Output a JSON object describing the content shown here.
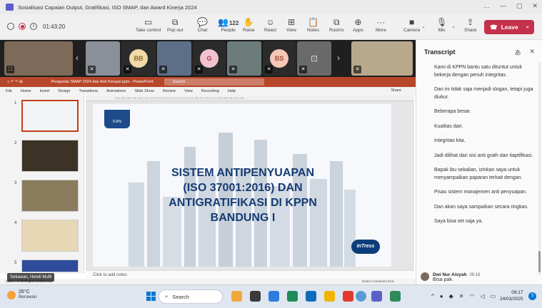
{
  "window": {
    "title": "Sosialisasi Capaian Output, Gratifikasi, ISO SMAP, dan Award Kinerja 2024",
    "controls": [
      "…",
      "—",
      "▢",
      "✕"
    ]
  },
  "meeting": {
    "timer": "01:43:20",
    "buttons": [
      {
        "label": "Take control",
        "icon": "▭"
      },
      {
        "label": "Pop out",
        "icon": "⧉"
      },
      {
        "label": "Chat",
        "icon": "💬"
      },
      {
        "label": "People",
        "icon": "👥",
        "count": "122"
      },
      {
        "label": "Raise",
        "icon": "✋"
      },
      {
        "label": "React",
        "icon": "☺"
      },
      {
        "label": "View",
        "icon": "⊞"
      },
      {
        "label": "Notes",
        "icon": "📋"
      },
      {
        "label": "Rooms",
        "icon": "⧉"
      },
      {
        "label": "Apps",
        "icon": "⊕"
      },
      {
        "label": "More",
        "icon": "···"
      },
      {
        "label": "Camera",
        "icon": "■"
      },
      {
        "label": "Mic",
        "icon": "🎙"
      },
      {
        "label": "Share",
        "icon": "⇪"
      }
    ],
    "leave_label": "Leave"
  },
  "participants": [
    {
      "type": "video",
      "color": "#7d6a58"
    },
    {
      "type": "video",
      "color": "#8a8f99"
    },
    {
      "type": "avatar",
      "initials": "BB",
      "bg": "#f1d9a8",
      "fg": "#8a6a2a"
    },
    {
      "type": "video",
      "color": "#5d6f86"
    },
    {
      "type": "avatar",
      "initials": "G",
      "bg": "#f3c2cf",
      "fg": "#a23a5a"
    },
    {
      "type": "video",
      "color": "#6b7c7a"
    },
    {
      "type": "avatar",
      "initials": "BS",
      "bg": "#f5c8b8",
      "fg": "#a04a35"
    },
    {
      "type": "avatar",
      "initials": "",
      "bg": "#6a6a6a",
      "fg": "#ddd"
    },
    {
      "type": "video",
      "color": "#b8a88c"
    }
  ],
  "ppt": {
    "filename": "Pengantar SMAP 2024 dan Anti Korupsi.pptx - PowerPoint",
    "search_placeholder": "Search",
    "menu": [
      "File",
      "Home",
      "Insert",
      "Design",
      "Transitions",
      "Animations",
      "Slide Show",
      "Review",
      "View",
      "Recording",
      "Help"
    ],
    "share_label": "Share",
    "slide_numbers": [
      "1",
      "2",
      "3",
      "4",
      "5"
    ],
    "slide_title_lines": [
      "SISTEM ANTIPENYUAPAN",
      "(ISO 37001:2016)  DAN",
      "ANTIGRATIFIKASI DI KPPN",
      "BANDUNG I"
    ],
    "logo_text": "DJPb",
    "badge_text": "InTress",
    "notes_placeholder": "Click to add notes",
    "status_text": "Slide 1 of 18    English (Indonesia)",
    "status_right": "Notes   Comments          51%"
  },
  "presenter_name": "Setiawan, Hendi Mufti",
  "transcript": {
    "title": "Transcript",
    "lines": [
      "Kami di KPPN bantu satu dituntut untuk bekerja dengan penuh integritas.",
      "Dan ini tidak saja menjadi slogan, tetapi juga diukur.",
      "Beberapa besar.",
      "Kualitas dari.",
      "Integritas kita.",
      "Jadi dilihat dari sisi anti grath dan tiaptifikasi.",
      "Bapak ibu sekalian, izinkan saya untuk menyampaikan paparan terkait dengan.",
      "Pisau sistem manajemen anti penyuapan.",
      "Dan akan saya sampaikan secara ringkas.",
      "Saya bisa set saja ya."
    ],
    "speaker": {
      "name": "Dwi Nur Aisyah",
      "time": "09:16",
      "text": "Bisa pak."
    }
  },
  "taskbar": {
    "weather_temp": "26°C",
    "weather_desc": "Berawan",
    "search_label": "Search",
    "clock_time": "09:17",
    "clock_date": "24/03/2025",
    "notif_count": "3",
    "app_colors": [
      "#f1a83b",
      "#3a3a3a",
      "#2d7de0",
      "#1f8a5a",
      "#0f6cbd",
      "#f0b400",
      "#e03a2f",
      "#5b9bd5",
      "#5b5fc7",
      "#2e8b57"
    ]
  }
}
